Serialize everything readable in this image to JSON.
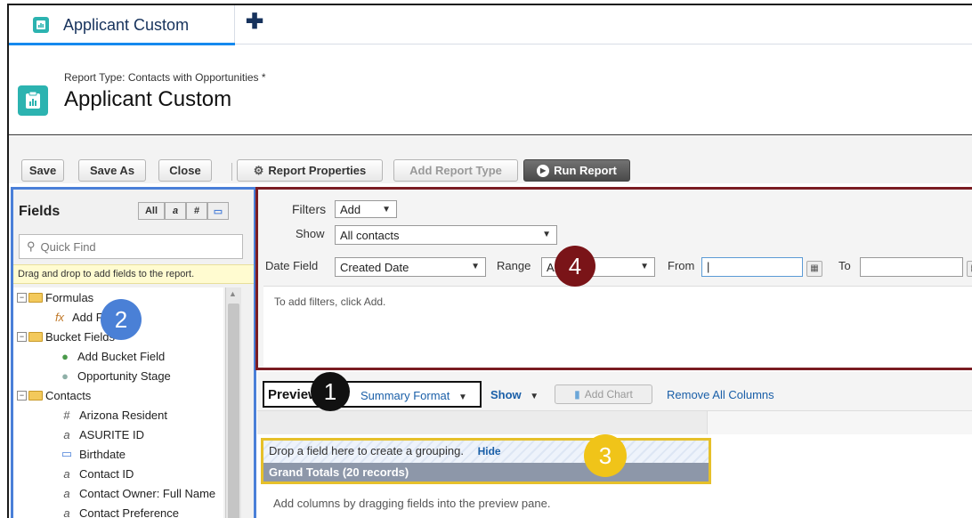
{
  "tabs": {
    "active_label": "Applicant Custom",
    "add_symbol": "✚"
  },
  "header": {
    "report_type": "Report Type: Contacts with Opportunities *",
    "title": "Applicant Custom"
  },
  "toolbar": {
    "save": "Save",
    "save_as": "Save As",
    "close": "Close",
    "report_properties": "Report Properties",
    "add_report_type": "Add Report Type",
    "run_report": "Run Report"
  },
  "fields": {
    "title": "Fields",
    "filter_all": "All",
    "filter_text": "a",
    "filter_number": "#",
    "filter_date": "▭",
    "quick_find_placeholder": "Quick Find",
    "drag_hint": "Drag and drop to add fields to the report.",
    "tree": {
      "formulas": "Formulas",
      "add_formula": "Add Formula",
      "bucket_fields": "Bucket Fields",
      "add_bucket_field": "Add Bucket Field",
      "opportunity_stage": "Opportunity Stage",
      "contacts": "Contacts",
      "arizona_resident": "Arizona Resident",
      "asurite_id": "ASURITE ID",
      "birthdate": "Birthdate",
      "contact_id": "Contact ID",
      "contact_owner": "Contact Owner: Full Name",
      "contact_preference": "Contact Preference"
    }
  },
  "filters": {
    "label": "Filters",
    "add_label": "Add",
    "show_label": "Show",
    "show_value": "All contacts",
    "date_field_label": "Date Field",
    "date_field_value": "Created Date",
    "range_label": "Range",
    "range_value": "All Time",
    "from_label": "From",
    "from_value": "|",
    "to_label": "To",
    "empty_hint": "To add filters, click Add."
  },
  "preview": {
    "label": "Preview",
    "format": "Summary Format",
    "show": "Show",
    "add_chart": "Add Chart",
    "remove_all": "Remove All Columns",
    "drop_hint": "Drop a field here to create a grouping.",
    "hide": "Hide",
    "grand_totals": "Grand Totals (20 records)",
    "add_columns_hint": "Add columns by dragging fields into the preview pane."
  },
  "callouts": {
    "one": "1",
    "two": "2",
    "three": "3",
    "four": "4"
  },
  "colors": {
    "accent_teal": "#2cb3b0",
    "fields_border": "#4a7fd8",
    "filters_border": "#7a1c22",
    "preview_border": "#111111",
    "grouping_border": "#e6c02a",
    "callout_1": "#111111",
    "callout_2": "#4a80d6",
    "callout_3": "#f0c419",
    "callout_4": "#7a1418"
  }
}
